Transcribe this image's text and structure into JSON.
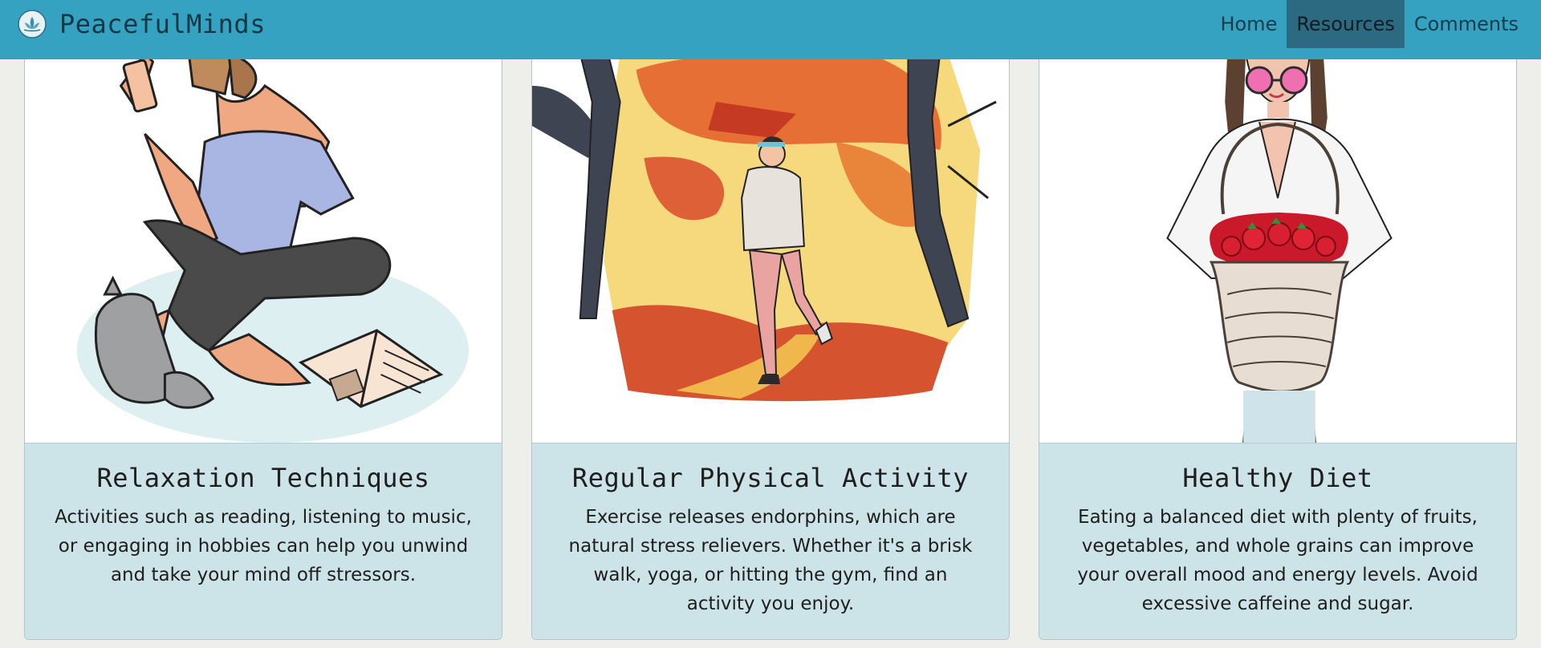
{
  "brand": {
    "name": "PeacefulMinds",
    "logo_icon": "lotus-icon"
  },
  "nav": {
    "items": [
      {
        "label": "Home",
        "active": false
      },
      {
        "label": "Resources",
        "active": true
      },
      {
        "label": "Comments",
        "active": false
      }
    ]
  },
  "cards": [
    {
      "title": "Relaxation Techniques",
      "text": "Activities such as reading, listening to music, or engaging in hobbies can help you unwind and take your mind off stressors.",
      "image": "woman-relaxing-with-cat-and-book-illustration"
    },
    {
      "title": "Regular Physical Activity",
      "text": "Exercise releases endorphins, which are natural stress relievers. Whether it's a brisk walk, yoga, or hitting the gym, find an activity you enjoy.",
      "image": "woman-running-through-autumn-forest-illustration"
    },
    {
      "title": "Healthy Diet",
      "text": "Eating a balanced diet with plenty of fruits, vegetables, and whole grains can improve your overall mood and energy levels. Avoid excessive caffeine and sugar.",
      "image": "woman-holding-strawberry-basket-illustration"
    }
  ],
  "colors": {
    "navbar": "#35a2c2",
    "nav_active": "#2b6a80",
    "page_background": "#eeefeb",
    "card_body": "#cce3e7"
  }
}
